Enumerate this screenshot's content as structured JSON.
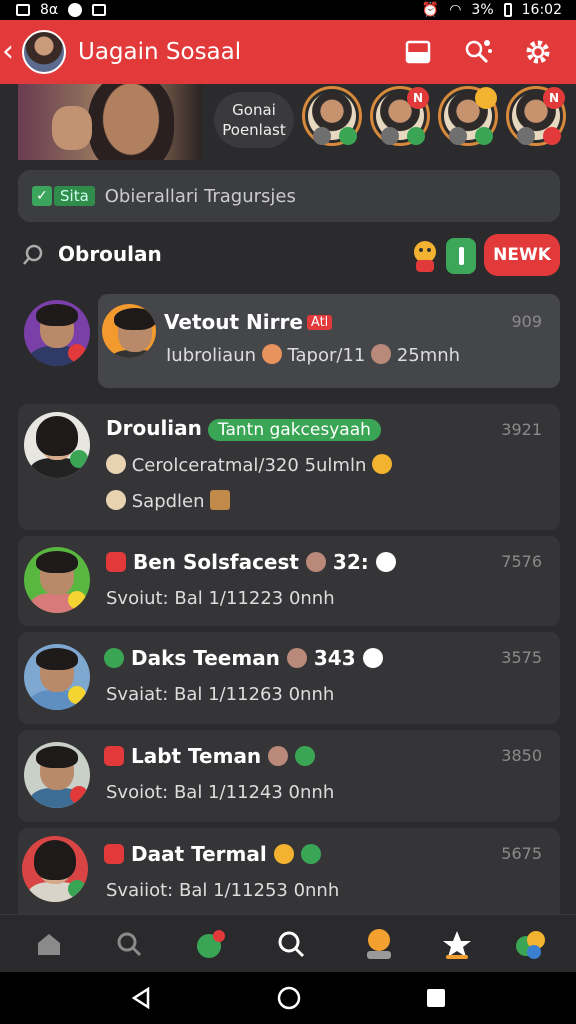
{
  "status_bar": {
    "left_text": "8α",
    "battery": "3%",
    "time": "16:02"
  },
  "app_bar": {
    "title": "Uagain Sosaal"
  },
  "stories": {
    "group_pill": [
      "Gonai",
      "Poenlast"
    ]
  },
  "notice": {
    "tag": "Sita",
    "text": "Obierallari Tragursjes"
  },
  "search": {
    "label": "Obroulan"
  },
  "new_button": {
    "label": "NEWK"
  },
  "chats": [
    {
      "name": "Vetout Nirre",
      "tag": "Atl",
      "sub_a": "Iubroliaun",
      "sub_b": "Tapor/11",
      "sub_c": "25mnh",
      "time": "909"
    },
    {
      "name": "Droulian",
      "chip": "Tantn gakcesyaah",
      "line1": "Cerolceratmal/320 5ulmln",
      "line2": "Sapdlen",
      "time": "3921"
    },
    {
      "name": "Ben Solsfacest",
      "extra": "32:",
      "sub": "Svoiut: Bal 1/11223 0nnh",
      "time": "7576"
    },
    {
      "name": "Daks Teeman",
      "extra": "343",
      "sub": "Svaiat: Bal 1/11263 0nnh",
      "time": "3575"
    },
    {
      "name": "Labt Teman",
      "sub": "Svoiot: Bal 1/11243 0nnh",
      "time": "3850"
    },
    {
      "name": "Daat Termal",
      "sub": "Svaiiot: Bal 1/11253 0nnh",
      "time": "5675"
    }
  ],
  "colors": {
    "accent": "#e23a3a",
    "green": "#3aa655",
    "background": "#2b2b2d",
    "card": "#353538"
  }
}
